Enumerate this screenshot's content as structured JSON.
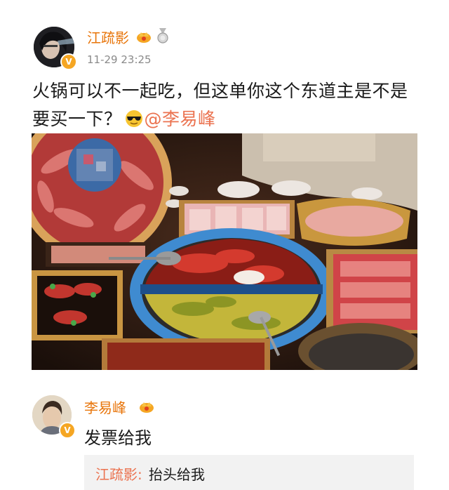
{
  "post": {
    "author": "江疏影",
    "timestamp": "11-29 23:25",
    "text_main": "火锅可以不一起吃，但这单你这个东道主是不是要买一下？",
    "emoji": "sunglasses-emoji",
    "mention": "@李易峰",
    "verified_badge": "V"
  },
  "reply": {
    "author": "李易峰",
    "text": "发票给我",
    "verified_badge": "V",
    "quote": {
      "author": "江疏影:",
      "text": "抬头给我"
    }
  },
  "colors": {
    "username": "#e8750a",
    "mention": "#eb7350",
    "badge": "#f5a623",
    "quote_bg": "#f2f2f2"
  }
}
